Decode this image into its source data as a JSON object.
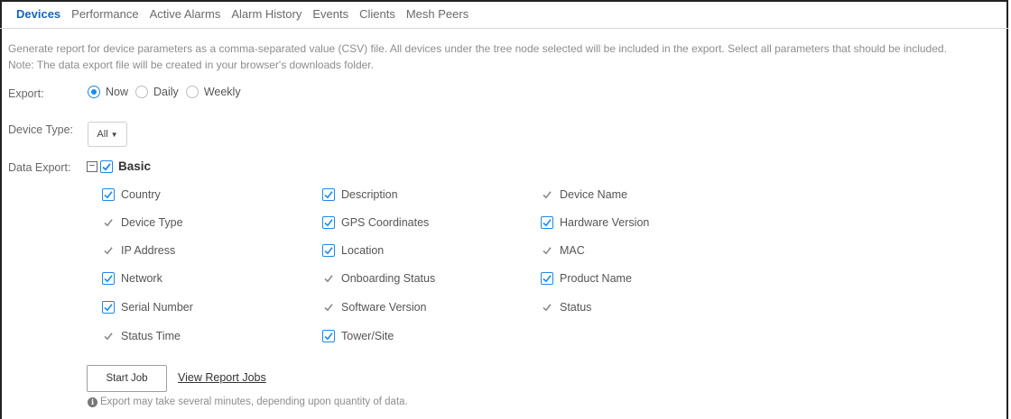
{
  "tabs": [
    {
      "label": "Devices",
      "active": true
    },
    {
      "label": "Performance",
      "active": false
    },
    {
      "label": "Active Alarms",
      "active": false
    },
    {
      "label": "Alarm History",
      "active": false
    },
    {
      "label": "Events",
      "active": false
    },
    {
      "label": "Clients",
      "active": false
    },
    {
      "label": "Mesh Peers",
      "active": false
    }
  ],
  "description": {
    "line1": "Generate report for device parameters as a comma-separated value (CSV) file. All devices under the tree node selected will be included in the export. Select all parameters that should be included.",
    "line2": "Note: The data export file will be created in your browser's downloads folder."
  },
  "export": {
    "label": "Export:",
    "options": [
      "Now",
      "Daily",
      "Weekly"
    ],
    "selected": "Now"
  },
  "device_type": {
    "label": "Device Type:",
    "value": "All"
  },
  "data_export": {
    "label": "Data Export:",
    "group_label": "Basic",
    "group_checked": true,
    "items": [
      {
        "label": "Country",
        "checked": true
      },
      {
        "label": "Description",
        "checked": true
      },
      {
        "label": "Device Name",
        "checked": false
      },
      {
        "label": "Device Type",
        "checked": false
      },
      {
        "label": "GPS Coordinates",
        "checked": true
      },
      {
        "label": "Hardware Version",
        "checked": true
      },
      {
        "label": "IP Address",
        "checked": false
      },
      {
        "label": "Location",
        "checked": true
      },
      {
        "label": "MAC",
        "checked": false
      },
      {
        "label": "Network",
        "checked": true
      },
      {
        "label": "Onboarding Status",
        "checked": false
      },
      {
        "label": "Product Name",
        "checked": true
      },
      {
        "label": "Serial Number",
        "checked": true
      },
      {
        "label": "Software Version",
        "checked": false
      },
      {
        "label": "Status",
        "checked": false
      },
      {
        "label": "Status Time",
        "checked": false
      },
      {
        "label": "Tower/Site",
        "checked": true
      }
    ]
  },
  "actions": {
    "start_job": "Start Job",
    "view_jobs": "View Report Jobs",
    "note": "Export may take several minutes, depending upon quantity of data."
  },
  "colors": {
    "accent": "#1e88e5",
    "active_tab": "#1565c0"
  }
}
